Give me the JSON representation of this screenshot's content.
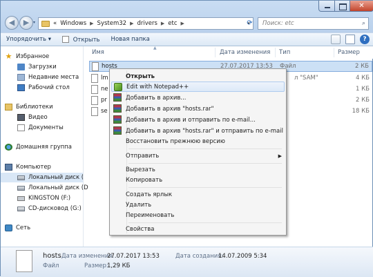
{
  "address": {
    "crumbs": [
      "Windows",
      "System32",
      "drivers",
      "etc"
    ],
    "prefix": "«"
  },
  "search": {
    "placeholder": "Поиск: etc"
  },
  "toolbar": {
    "organize": "Упорядочить ▾",
    "open": "Открыть",
    "new_folder": "Новая папка"
  },
  "sidebar": {
    "items": [
      {
        "label": "Избранное",
        "icon": "star-icon"
      },
      {
        "label": "Загрузки",
        "icon": "downloads-icon"
      },
      {
        "label": "Недавние места",
        "icon": "recent-places-icon"
      },
      {
        "label": "Рабочий стол",
        "icon": "desktop-icon"
      },
      {
        "label": "Библиотеки",
        "icon": "libraries-icon"
      },
      {
        "label": "Видео",
        "icon": "video-icon"
      },
      {
        "label": "Документы",
        "icon": "documents-icon"
      },
      {
        "label": "Домашняя группа",
        "icon": "homegroup-icon"
      },
      {
        "label": "Компьютер",
        "icon": "computer-icon"
      },
      {
        "label": "Локальный диск (C",
        "icon": "drive-icon"
      },
      {
        "label": "Локальный диск (D",
        "icon": "drive-icon"
      },
      {
        "label": "KINGSTON (F:)",
        "icon": "usb-drive-icon"
      },
      {
        "label": "CD-дисковод (G:)",
        "icon": "cd-drive-icon"
      },
      {
        "label": "Сеть",
        "icon": "network-icon"
      }
    ]
  },
  "columns": {
    "name": "Имя",
    "date": "Дата изменения",
    "type": "Тип",
    "size": "Размер"
  },
  "files": [
    {
      "name": "hosts",
      "date": "27.07.2017 13:53",
      "type": "Файл",
      "size": "2 КБ"
    },
    {
      "name": "lm",
      "date": "",
      "type": "л \"SAM\"",
      "size": "4 КБ"
    },
    {
      "name": "ne",
      "date": "",
      "type": "",
      "size": "1 КБ"
    },
    {
      "name": "pr",
      "date": "",
      "type": "",
      "size": "2 КБ"
    },
    {
      "name": "se",
      "date": "",
      "type": "",
      "size": "18 КБ"
    }
  ],
  "context_menu": [
    {
      "label": "Открыть",
      "bold": true
    },
    {
      "label": "Edit with Notepad++",
      "icon": "notepad-plus-plus-icon"
    },
    {
      "label": "Добавить в архив...",
      "icon": "winrar-icon"
    },
    {
      "label": "Добавить в архив \"hosts.rar\"",
      "icon": "winrar-icon"
    },
    {
      "label": "Добавить в архив и отправить по e-mail...",
      "icon": "winrar-icon"
    },
    {
      "label": "Добавить в архив \"hosts.rar\" и отправить по e-mail",
      "icon": "winrar-icon"
    },
    {
      "label": "Восстановить прежнюю версию"
    },
    {
      "label": "Отправить",
      "submenu": true
    },
    {
      "label": "Вырезать"
    },
    {
      "label": "Копировать"
    },
    {
      "label": "Создать ярлык"
    },
    {
      "label": "Удалить"
    },
    {
      "label": "Переименовать"
    },
    {
      "label": "Свойства"
    }
  ],
  "details": {
    "name": "hosts",
    "type": "Файл",
    "modified_label": "Дата изменения:",
    "modified_value": "27.07.2017 13:53",
    "size_label": "Размер:",
    "size_value": "1,29 КБ",
    "created_label": "Дата создания:",
    "created_value": "14.07.2009 5:34"
  },
  "colors": {
    "accent": "#2f6fc0",
    "selection": "#cce0f5",
    "frame": "#c9ddf3"
  }
}
